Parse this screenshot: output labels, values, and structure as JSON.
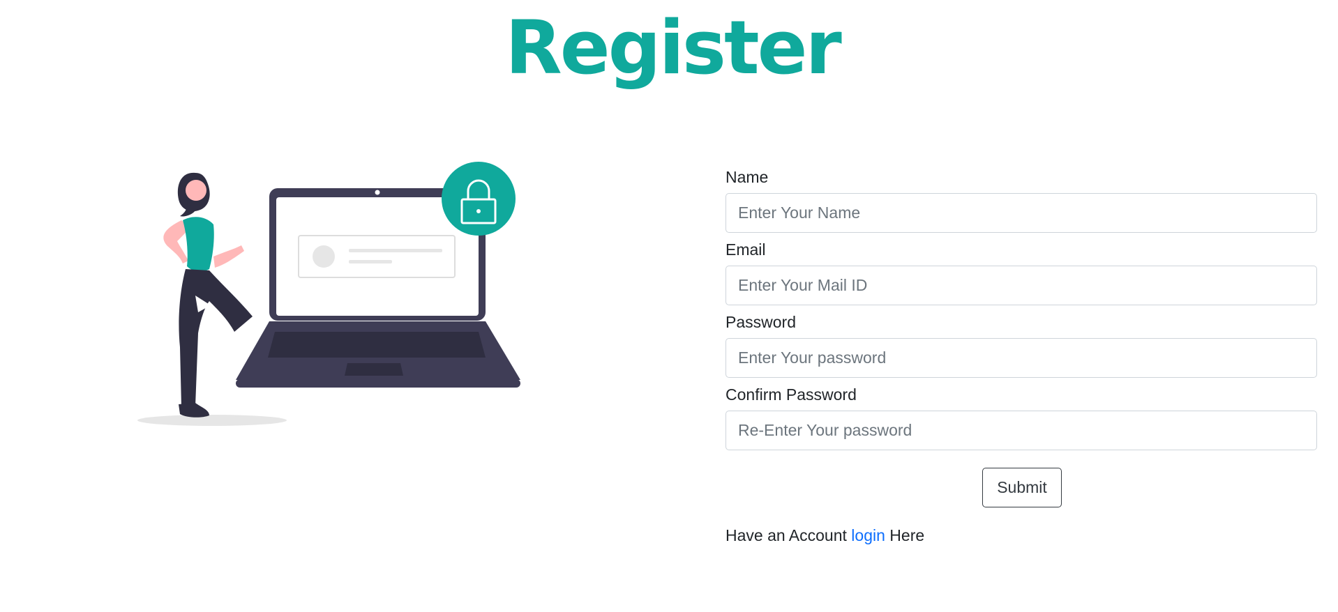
{
  "page": {
    "title": "Register"
  },
  "form": {
    "fields": [
      {
        "label": "Name",
        "placeholder": "Enter Your Name",
        "value": ""
      },
      {
        "label": "Email",
        "placeholder": "Enter Your Mail ID",
        "value": ""
      },
      {
        "label": "Password",
        "placeholder": "Enter Your password",
        "value": ""
      },
      {
        "label": "Confirm Password",
        "placeholder": "Re-Enter Your password",
        "value": ""
      }
    ],
    "submit_label": "Submit"
  },
  "footer": {
    "prefix": "Have an Account",
    "link_label": "login",
    "suffix": "Here"
  },
  "illustration": {
    "icon": "lock-icon",
    "colors": {
      "accent": "#10a99c",
      "dark": "#3f3d56",
      "skin": "#ffb8b8"
    }
  },
  "colors": {
    "title": "#10a99c",
    "link": "#0d6efd",
    "border": "#ced4da",
    "text": "#212529"
  }
}
